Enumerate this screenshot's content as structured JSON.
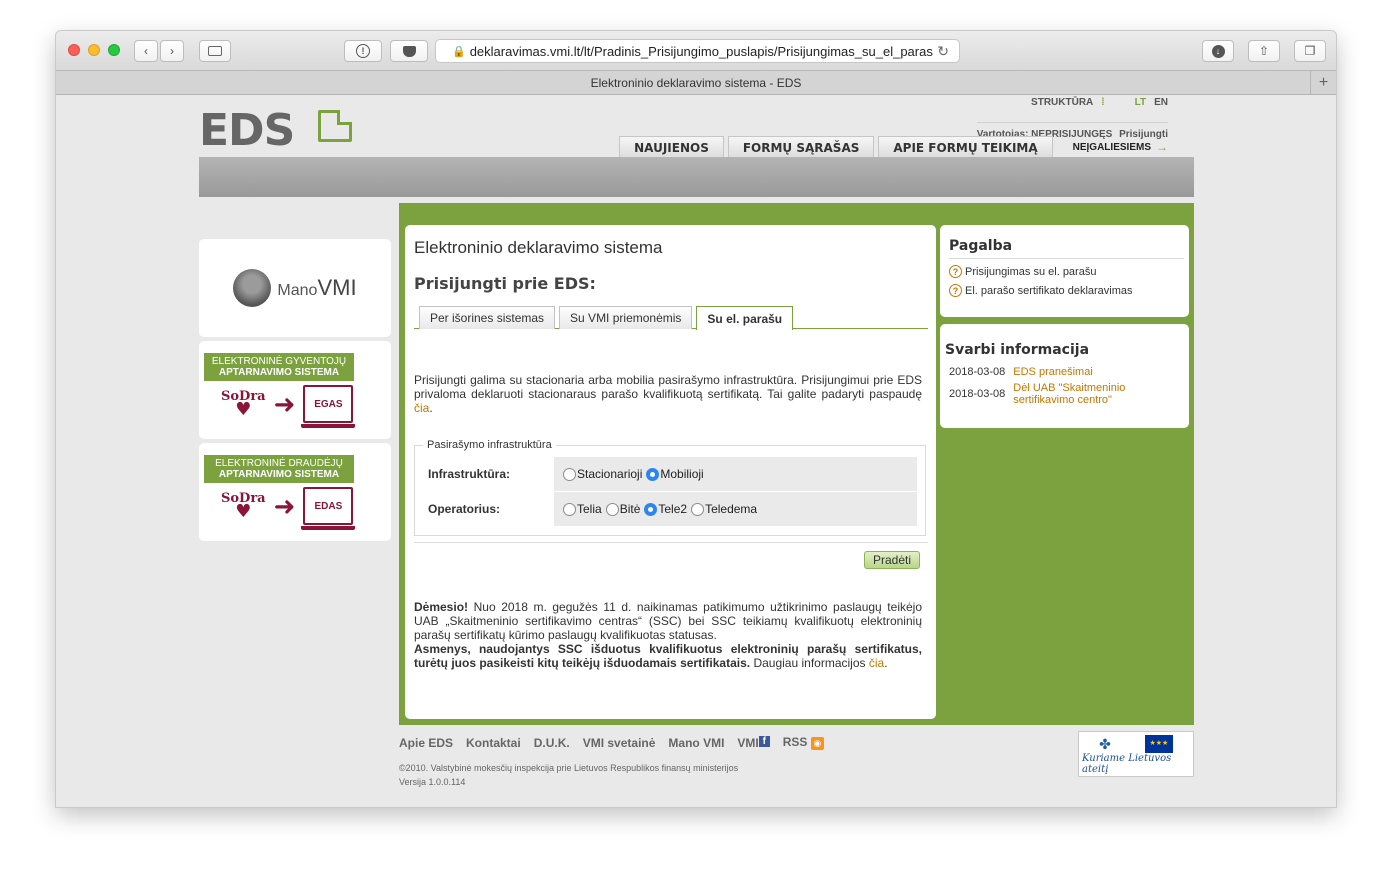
{
  "browser": {
    "url": "deklaravimas.vmi.lt/lt/Pradinis_Prisijungimo_puslapis/Prisijungimas_su_el_paras",
    "tab_title": "Elektroninio deklaravimo sistema - EDS"
  },
  "header": {
    "logo": "EDS",
    "structure_label": "STRUKTŪRA",
    "lang_lt": "LT",
    "lang_en": "EN",
    "user_label": "Vartotojas: NEPRISIJUNGĘS",
    "login_link": "Prisijungti",
    "nav": [
      "NAUJIENOS",
      "FORMŲ SĄRAŠAS",
      "APIE FORMŲ TEIKIMĄ"
    ],
    "special_nav": "NEĮGALIESIEMS"
  },
  "left": {
    "manovmi_prefix": "Mano",
    "manovmi_bold": "VMI",
    "promo1": {
      "line1": "ELEKTRONINĖ GYVENTOJŲ",
      "line2": "APTARNAVIMO SISTEMA",
      "sodra": "SoDra",
      "screen": "EGAS"
    },
    "promo2": {
      "line1": "ELEKTRONINĖ DRAUDĖJŲ",
      "line2": "APTARNAVIMO SISTEMA",
      "sodra": "SoDra",
      "screen": "EDAS"
    }
  },
  "main": {
    "title": "Elektroninio deklaravimo sistema",
    "subtitle": "Prisijungti prie EDS:",
    "tabs": [
      {
        "label": "Per išorines sistemas",
        "active": false
      },
      {
        "label": "Su VMI priemonėmis",
        "active": false
      },
      {
        "label": "Su el. parašu",
        "active": true
      }
    ],
    "intro": "Prisijungti galima su stacionaria arba mobilia pasirašymo infrastruktūra. Prisijungimui prie EDS privaloma deklaruoti stacionaraus parašo kvalifikuotą sertifikatą. Tai galite padaryti paspaudę",
    "intro_link": "čia",
    "intro_end": ".",
    "fieldset_legend": "Pasirašymo infrastruktūra",
    "infra_label": "Infrastruktūra:",
    "infra_options": [
      {
        "label": "Stacionarioji",
        "selected": false
      },
      {
        "label": "Mobilioji",
        "selected": true
      }
    ],
    "operator_label": "Operatorius:",
    "operator_options": [
      {
        "label": "Telia",
        "selected": false
      },
      {
        "label": "Bitė",
        "selected": false
      },
      {
        "label": "Tele2",
        "selected": true
      },
      {
        "label": "Teledema",
        "selected": false
      }
    ],
    "start_button": "Pradėti",
    "attention_bold": "Dėmesio!",
    "attention_text": " Nuo 2018 m. gegužės 11 d. naikinamas patikimumo užtikrinimo paslaugų teikėjo UAB „Skaitmeninio sertifikavimo centras“ (SSC) bei SSC teikiamų kvalifikuotų elektroninių parašų sertifikatų kūrimo paslaugų kvalifikuotas statusas.",
    "attention_bold2": "Asmenys, naudojantys SSC išduotus kvalifikuotus elektroninių parašų sertifikatus, turėtų juos pasikeisti kitų teikėjų išduodamais sertifikatais.",
    "attention_more": " Daugiau informacijos ",
    "attention_link": "čia",
    "attention_end": "."
  },
  "help": {
    "title": "Pagalba",
    "items": [
      "Prisijungimas su el. parašu",
      "El. parašo sertifikato deklaravimas"
    ]
  },
  "info": {
    "title": "Svarbi informacija",
    "rows": [
      {
        "date": "2018-03-08",
        "text": "EDS pranešimai"
      },
      {
        "date": "2018-03-08",
        "text": "Dėl UAB \"Skaitmeninio sertifikavimo centro\""
      }
    ]
  },
  "footer": {
    "links": [
      "Apie EDS",
      "Kontaktai",
      "D.U.K.",
      "VMI svetainė",
      "Mano VMI",
      "VMI",
      "RSS"
    ],
    "copyright": "©2010. Valstybinė mokesčių inspekcija prie Lietuvos Respublikos finansų ministerijos",
    "version": "Versija 1.0.0.114",
    "eu_slogan": "Kuriame Lietuvos ateitį"
  }
}
